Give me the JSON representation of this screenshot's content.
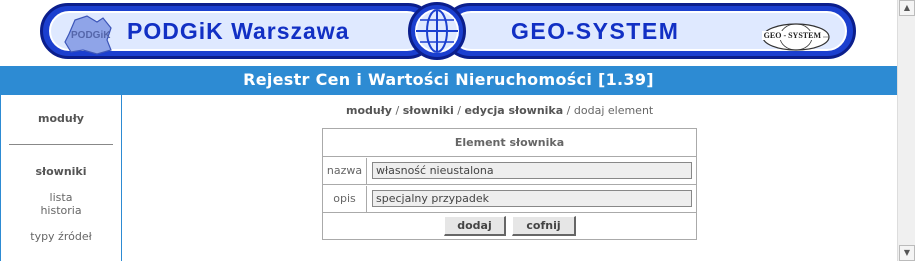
{
  "banner": {
    "left_text": "PODGiK  Warszawa",
    "left_logo_text": "PODGiK",
    "right_text": "GEO-SYSTEM",
    "right_stamp_text": "GEO - SYSTEM"
  },
  "title": "Rejestr Cen i Wartości Nieruchomości [1.39]",
  "sidebar": {
    "modules_label": "moduły",
    "section_label": "słowniki",
    "items": [
      {
        "label": "lista"
      },
      {
        "label": "historia"
      },
      {
        "label": "typy źródeł"
      }
    ]
  },
  "breadcrumb": {
    "items": [
      {
        "label": "moduły"
      },
      {
        "label": "słowniki"
      },
      {
        "label": "edycja słownika"
      }
    ],
    "current": "dodaj element",
    "separator": " / "
  },
  "form": {
    "title": "Element słownika",
    "fields": [
      {
        "label": "nazwa",
        "value": "własność nieustalona"
      },
      {
        "label": "opis",
        "value": "specjalny przypadek"
      }
    ],
    "buttons": {
      "add": "dodaj",
      "back": "cofnij"
    }
  },
  "colors": {
    "title_bar": "#2d8bd3",
    "banner_blue": "#1b3fcf"
  }
}
